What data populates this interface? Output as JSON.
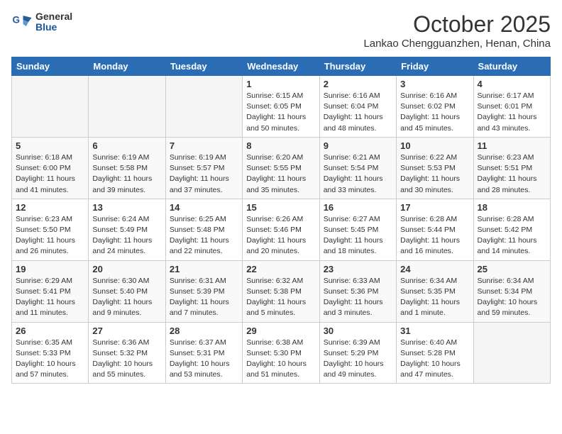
{
  "header": {
    "logo_general": "General",
    "logo_blue": "Blue",
    "month_title": "October 2025",
    "location": "Lankao Chengguanzhen, Henan, China"
  },
  "days_of_week": [
    "Sunday",
    "Monday",
    "Tuesday",
    "Wednesday",
    "Thursday",
    "Friday",
    "Saturday"
  ],
  "weeks": [
    [
      {
        "day": "",
        "empty": true
      },
      {
        "day": "",
        "empty": true
      },
      {
        "day": "",
        "empty": true
      },
      {
        "day": "1",
        "sunrise": "Sunrise: 6:15 AM",
        "sunset": "Sunset: 6:05 PM",
        "daylight": "Daylight: 11 hours and 50 minutes."
      },
      {
        "day": "2",
        "sunrise": "Sunrise: 6:16 AM",
        "sunset": "Sunset: 6:04 PM",
        "daylight": "Daylight: 11 hours and 48 minutes."
      },
      {
        "day": "3",
        "sunrise": "Sunrise: 6:16 AM",
        "sunset": "Sunset: 6:02 PM",
        "daylight": "Daylight: 11 hours and 45 minutes."
      },
      {
        "day": "4",
        "sunrise": "Sunrise: 6:17 AM",
        "sunset": "Sunset: 6:01 PM",
        "daylight": "Daylight: 11 hours and 43 minutes."
      }
    ],
    [
      {
        "day": "5",
        "sunrise": "Sunrise: 6:18 AM",
        "sunset": "Sunset: 6:00 PM",
        "daylight": "Daylight: 11 hours and 41 minutes."
      },
      {
        "day": "6",
        "sunrise": "Sunrise: 6:19 AM",
        "sunset": "Sunset: 5:58 PM",
        "daylight": "Daylight: 11 hours and 39 minutes."
      },
      {
        "day": "7",
        "sunrise": "Sunrise: 6:19 AM",
        "sunset": "Sunset: 5:57 PM",
        "daylight": "Daylight: 11 hours and 37 minutes."
      },
      {
        "day": "8",
        "sunrise": "Sunrise: 6:20 AM",
        "sunset": "Sunset: 5:55 PM",
        "daylight": "Daylight: 11 hours and 35 minutes."
      },
      {
        "day": "9",
        "sunrise": "Sunrise: 6:21 AM",
        "sunset": "Sunset: 5:54 PM",
        "daylight": "Daylight: 11 hours and 33 minutes."
      },
      {
        "day": "10",
        "sunrise": "Sunrise: 6:22 AM",
        "sunset": "Sunset: 5:53 PM",
        "daylight": "Daylight: 11 hours and 30 minutes."
      },
      {
        "day": "11",
        "sunrise": "Sunrise: 6:23 AM",
        "sunset": "Sunset: 5:51 PM",
        "daylight": "Daylight: 11 hours and 28 minutes."
      }
    ],
    [
      {
        "day": "12",
        "sunrise": "Sunrise: 6:23 AM",
        "sunset": "Sunset: 5:50 PM",
        "daylight": "Daylight: 11 hours and 26 minutes."
      },
      {
        "day": "13",
        "sunrise": "Sunrise: 6:24 AM",
        "sunset": "Sunset: 5:49 PM",
        "daylight": "Daylight: 11 hours and 24 minutes."
      },
      {
        "day": "14",
        "sunrise": "Sunrise: 6:25 AM",
        "sunset": "Sunset: 5:48 PM",
        "daylight": "Daylight: 11 hours and 22 minutes."
      },
      {
        "day": "15",
        "sunrise": "Sunrise: 6:26 AM",
        "sunset": "Sunset: 5:46 PM",
        "daylight": "Daylight: 11 hours and 20 minutes."
      },
      {
        "day": "16",
        "sunrise": "Sunrise: 6:27 AM",
        "sunset": "Sunset: 5:45 PM",
        "daylight": "Daylight: 11 hours and 18 minutes."
      },
      {
        "day": "17",
        "sunrise": "Sunrise: 6:28 AM",
        "sunset": "Sunset: 5:44 PM",
        "daylight": "Daylight: 11 hours and 16 minutes."
      },
      {
        "day": "18",
        "sunrise": "Sunrise: 6:28 AM",
        "sunset": "Sunset: 5:42 PM",
        "daylight": "Daylight: 11 hours and 14 minutes."
      }
    ],
    [
      {
        "day": "19",
        "sunrise": "Sunrise: 6:29 AM",
        "sunset": "Sunset: 5:41 PM",
        "daylight": "Daylight: 11 hours and 11 minutes."
      },
      {
        "day": "20",
        "sunrise": "Sunrise: 6:30 AM",
        "sunset": "Sunset: 5:40 PM",
        "daylight": "Daylight: 11 hours and 9 minutes."
      },
      {
        "day": "21",
        "sunrise": "Sunrise: 6:31 AM",
        "sunset": "Sunset: 5:39 PM",
        "daylight": "Daylight: 11 hours and 7 minutes."
      },
      {
        "day": "22",
        "sunrise": "Sunrise: 6:32 AM",
        "sunset": "Sunset: 5:38 PM",
        "daylight": "Daylight: 11 hours and 5 minutes."
      },
      {
        "day": "23",
        "sunrise": "Sunrise: 6:33 AM",
        "sunset": "Sunset: 5:36 PM",
        "daylight": "Daylight: 11 hours and 3 minutes."
      },
      {
        "day": "24",
        "sunrise": "Sunrise: 6:34 AM",
        "sunset": "Sunset: 5:35 PM",
        "daylight": "Daylight: 11 hours and 1 minute."
      },
      {
        "day": "25",
        "sunrise": "Sunrise: 6:34 AM",
        "sunset": "Sunset: 5:34 PM",
        "daylight": "Daylight: 10 hours and 59 minutes."
      }
    ],
    [
      {
        "day": "26",
        "sunrise": "Sunrise: 6:35 AM",
        "sunset": "Sunset: 5:33 PM",
        "daylight": "Daylight: 10 hours and 57 minutes."
      },
      {
        "day": "27",
        "sunrise": "Sunrise: 6:36 AM",
        "sunset": "Sunset: 5:32 PM",
        "daylight": "Daylight: 10 hours and 55 minutes."
      },
      {
        "day": "28",
        "sunrise": "Sunrise: 6:37 AM",
        "sunset": "Sunset: 5:31 PM",
        "daylight": "Daylight: 10 hours and 53 minutes."
      },
      {
        "day": "29",
        "sunrise": "Sunrise: 6:38 AM",
        "sunset": "Sunset: 5:30 PM",
        "daylight": "Daylight: 10 hours and 51 minutes."
      },
      {
        "day": "30",
        "sunrise": "Sunrise: 6:39 AM",
        "sunset": "Sunset: 5:29 PM",
        "daylight": "Daylight: 10 hours and 49 minutes."
      },
      {
        "day": "31",
        "sunrise": "Sunrise: 6:40 AM",
        "sunset": "Sunset: 5:28 PM",
        "daylight": "Daylight: 10 hours and 47 minutes."
      },
      {
        "day": "",
        "empty": true
      }
    ]
  ]
}
